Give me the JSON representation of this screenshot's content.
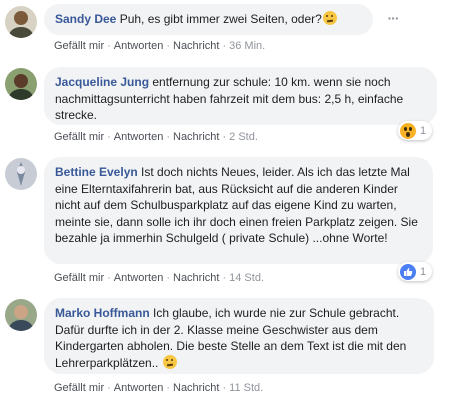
{
  "comments": [
    {
      "author": "Sandy Dee",
      "text": "Puh, es gibt immer zwei Seiten, oder?",
      "emoji": "thinking-face-emoji",
      "actions": {
        "like": "Gefällt mir",
        "reply": "Antworten",
        "message": "Nachricht",
        "time": "36 Min."
      }
    },
    {
      "author": "Jacqueline Jung",
      "text": "entfernung zur schule: 10 km. wenn sie noch nachmittagsunterricht haben fahrzeit mit dem bus: 2,5 h, einfache strecke.",
      "actions": {
        "like": "Gefällt mir",
        "reply": "Antworten",
        "message": "Nachricht",
        "time": "2 Std."
      },
      "reaction": {
        "icon": "wow-reaction-icon",
        "count": "1"
      }
    },
    {
      "author": "Bettine Evelyn",
      "text": "Ist doch nichts Neues, leider. Als ich das letzte Mal eine Elterntaxifahrerin bat, aus Rücksicht auf die anderen Kinder nicht auf dem Schulbusparkplatz auf das eigene Kind zu warten, meinte sie, dann solle ich ihr doch einen freien Parkplatz zeigen. Sie bezahle ja immerhin Schulgeld ( private Schule) ...ohne Worte!",
      "actions": {
        "like": "Gefällt mir",
        "reply": "Antworten",
        "message": "Nachricht",
        "time": "14 Std."
      },
      "reaction": {
        "icon": "like-reaction-icon",
        "count": "1"
      }
    },
    {
      "author": "Marko Hoffmann",
      "text": "Ich glaube, ich wurde nie zur Schule gebracht. Dafür durfte ich in der 2. Klasse meine Geschwister aus dem Kindergarten abholen. Die beste Stelle an dem Text ist die mit den Lehrerparkplätzen..",
      "emoji": "smiling-face-emoji",
      "actions": {
        "like": "Gefällt mir",
        "reply": "Antworten",
        "message": "Nachricht",
        "time": "11 Std."
      }
    }
  ],
  "colors": {
    "author": "#385898",
    "bubble": "#f2f3f5",
    "meta": "#90949c",
    "like_blue": "#4a7ff5",
    "wow_yellow": "#f7b125"
  }
}
